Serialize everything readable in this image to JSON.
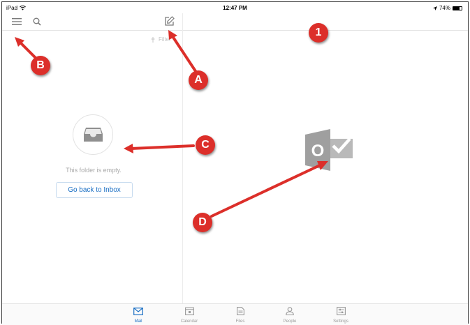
{
  "status_bar": {
    "device": "iPad",
    "time": "12:47 PM",
    "battery": "74%",
    "battery_level": 0.74
  },
  "left_pane": {
    "filter_label": "Filter",
    "empty_message": "This folder is empty.",
    "back_button_label": "Go back to Inbox"
  },
  "logo": {
    "letter": "O"
  },
  "tabs": [
    {
      "label": "Mail",
      "icon": "mail-icon",
      "active": true
    },
    {
      "label": "Calendar",
      "icon": "calendar-icon",
      "active": false
    },
    {
      "label": "Files",
      "icon": "files-icon",
      "active": false
    },
    {
      "label": "People",
      "icon": "people-icon",
      "active": false
    },
    {
      "label": "Settings",
      "icon": "settings-icon",
      "active": false
    }
  ],
  "annotations": {
    "A": "A",
    "B": "B",
    "C": "C",
    "D": "D",
    "one": "1"
  },
  "colors": {
    "accent": "#1a6fc4",
    "annotation_red": "#dc2f2a",
    "logo_gray": "#a3a3a3"
  }
}
